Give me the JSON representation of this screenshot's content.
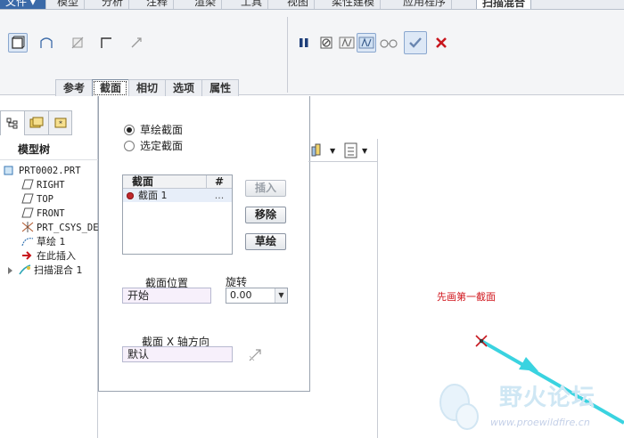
{
  "menubar": {
    "tabs": [
      "文件 ▾",
      "模型",
      "分析",
      "注释",
      "渲染",
      "工具",
      "视图",
      "柔性建模",
      "应用程序",
      "扫描混合"
    ]
  },
  "ribbon": {
    "left_icons": [
      "solid-icon",
      "surface-icon",
      "remove-material-icon",
      "thicken-icon",
      "remove-section-icon"
    ],
    "right_icons": [
      "pause-icon",
      "no-preview-icon",
      "preview-box-icon",
      "verify-icon",
      "glasses-icon",
      "ok-icon",
      "cancel-icon"
    ],
    "subtabs": [
      "参考",
      "截面",
      "相切",
      "选项",
      "属性"
    ],
    "active_subtab": "截面"
  },
  "left_panel": {
    "title": "模型树",
    "tree": [
      {
        "label": "PRT0002.PRT",
        "icon": "part-icon"
      },
      {
        "label": "RIGHT",
        "icon": "datum-plane-icon"
      },
      {
        "label": "TOP",
        "icon": "datum-plane-icon"
      },
      {
        "label": "FRONT",
        "icon": "datum-plane-icon"
      },
      {
        "label": "PRT_CSYS_DEF",
        "icon": "csys-icon"
      },
      {
        "label": "草绘 1",
        "icon": "sketch-icon"
      },
      {
        "label": "在此插入",
        "icon": "insert-arrow-icon"
      },
      {
        "label": "扫描混合 1",
        "icon": "sweep-blend-icon"
      }
    ]
  },
  "sections_panel": {
    "radio_sketched": "草绘截面",
    "radio_selected": "选定截面",
    "list_header": "截面",
    "list_header_count": "#",
    "row_label": "截面 1",
    "row_value": "...",
    "btn_insert": "插入",
    "btn_remove": "移除",
    "btn_sketch": "草绘",
    "position_label": "截面位置",
    "position_value": "开始",
    "rotation_label": "旋转",
    "rotation_value": "0.00",
    "xaxis_label": "截面 X 轴方向",
    "xaxis_value": "默认"
  },
  "graphics": {
    "hint_text": "先画第一截面"
  },
  "watermark": {
    "cn": "野火论坛",
    "url": "www.proewildfire.cn"
  },
  "colors": {
    "accent_blue": "#3b6aa8",
    "hint_red": "#d0141b",
    "trajectory_cyan": "#3ad3e0"
  }
}
